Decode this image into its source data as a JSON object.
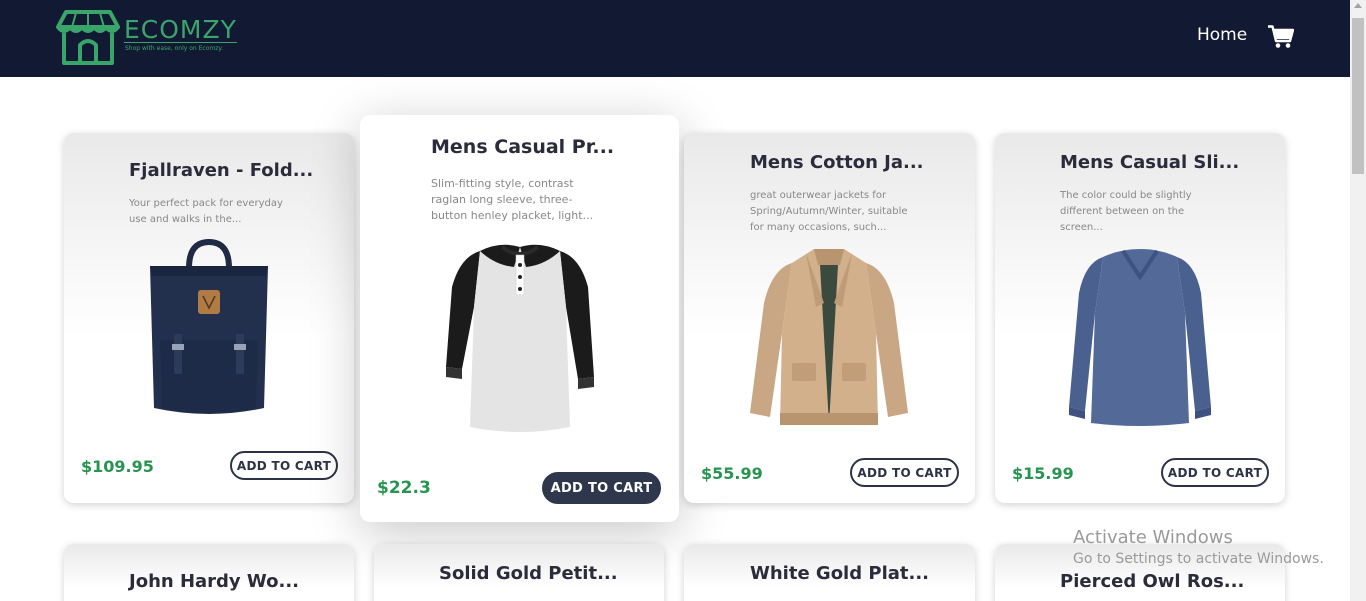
{
  "nav": {
    "brand": "ECOMZY",
    "tagline": "Shop with ease, only on Ecomzy.",
    "home_label": "Home",
    "cart_icon": "shopping-cart-icon",
    "bg_color": "#121a33",
    "brand_color": "#3aa56a"
  },
  "products": [
    {
      "title": "Fjallraven - Fold...",
      "desc": "Your perfect pack for everyday use and walks in the...",
      "price": "$109.95",
      "button": "ADD TO CART",
      "image": "backpack"
    },
    {
      "title": "Mens Casual Pr...",
      "desc": "Slim-fitting style, contrast raglan long sleeve, three-button henley placket, light...",
      "price": "$22.3",
      "button": "ADD TO CART",
      "image": "raglan-shirt"
    },
    {
      "title": "Mens Cotton Ja...",
      "desc": "great outerwear jackets for Spring/Autumn/Winter, suitable for many occasions, such...",
      "price": "$55.99",
      "button": "ADD TO CART",
      "image": "jacket"
    },
    {
      "title": "Mens Casual Sli...",
      "desc": "The color could be slightly different between on the screen...",
      "price": "$15.99",
      "button": "ADD TO CART",
      "image": "slim-shirt"
    },
    {
      "title": "John Hardy Wo..."
    },
    {
      "title": "Solid Gold Petit..."
    },
    {
      "title": "White Gold Plat..."
    },
    {
      "title": "Pierced Owl Ros..."
    }
  ],
  "watermark": {
    "title": "Activate Windows",
    "subtitle": "Go to Settings to activate Windows."
  },
  "colors": {
    "price": "#27944f",
    "button_dark": "#2f374c"
  }
}
